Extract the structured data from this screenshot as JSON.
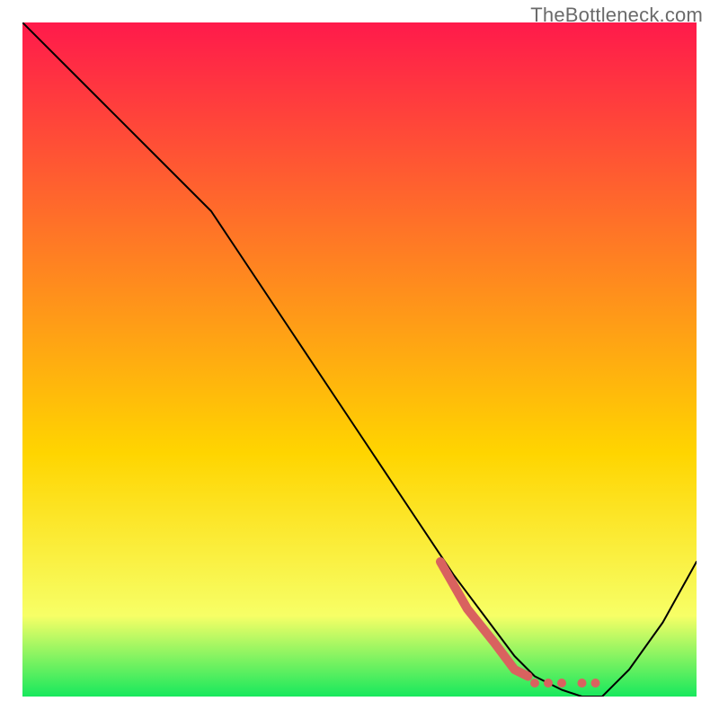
{
  "watermark": "TheBottleneck.com",
  "chart_data": {
    "type": "line",
    "title": "",
    "xlabel": "",
    "ylabel": "",
    "xlim": [
      0,
      100
    ],
    "ylim": [
      0,
      100
    ],
    "grid": false,
    "legend": false,
    "background_gradient": {
      "top_color": "#ff1a4b",
      "mid_color": "#ffd500",
      "mid_stop": 64,
      "near_bottom_color": "#f7ff66",
      "near_bottom_stop": 88,
      "bottom_color": "#17e85d"
    },
    "series": [
      {
        "name": "bottleneck-curve",
        "color": "#000000",
        "stroke_width": 2,
        "x": [
          0,
          6,
          12,
          18,
          24,
          28,
          34,
          40,
          46,
          52,
          58,
          64,
          70,
          73,
          76,
          80,
          83,
          86,
          90,
          95,
          100
        ],
        "y": [
          100,
          94,
          88,
          82,
          76,
          72,
          63,
          54,
          45,
          36,
          27,
          18,
          10,
          6,
          3,
          1,
          0,
          0,
          4,
          11,
          20
        ]
      },
      {
        "name": "highlight-curve",
        "color": "#d9625f",
        "stroke_width": 10,
        "style": "solid-then-dotted",
        "x": [
          62,
          66,
          70,
          73,
          75
        ],
        "y": [
          20,
          13,
          8,
          4,
          3
        ],
        "dots": [
          {
            "x": 76,
            "y": 2
          },
          {
            "x": 78,
            "y": 2
          },
          {
            "x": 80,
            "y": 2
          },
          {
            "x": 83,
            "y": 2
          },
          {
            "x": 85,
            "y": 2
          }
        ]
      }
    ]
  }
}
